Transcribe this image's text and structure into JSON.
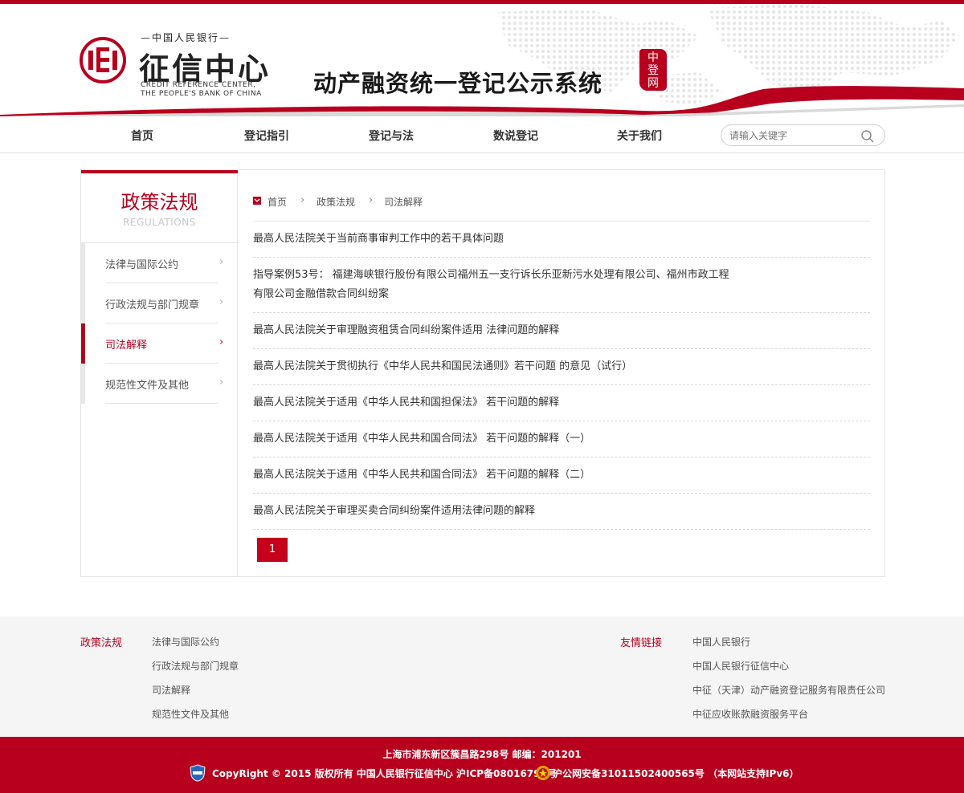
{
  "header": {
    "logo_top": "—中国人民银行—",
    "logo_main": "征信中心",
    "logo_en_line1": "CREDIT REFERENCE CENTER,",
    "logo_en_line2": "THE PEOPLE'S BANK OF CHINA",
    "system_title": "动产融资统一登记公示系统",
    "stamp_text": "中登网"
  },
  "nav": {
    "items": [
      "首页",
      "登记指引",
      "登记与法",
      "数说登记",
      "关于我们"
    ],
    "search_placeholder": "请输入关键字"
  },
  "sidebar": {
    "title": "政策法规",
    "subtitle": "REGULATIONS",
    "items": [
      {
        "label": "法律与国际公约",
        "active": false
      },
      {
        "label": "行政法规与部门规章",
        "active": false
      },
      {
        "label": "司法解释",
        "active": true
      },
      {
        "label": "规范性文件及其他",
        "active": false
      }
    ]
  },
  "breadcrumb": [
    "首页",
    "政策法规",
    "司法解释"
  ],
  "articles": [
    {
      "lines": [
        "最高人民法院关于当前商事审判工作中的若干具体问题"
      ]
    },
    {
      "lines": [
        "指导案例53号： 福建海峡银行股份有限公司福州五一支行诉长乐亚新污水处理有限公司、福州市政工程",
        "有限公司金融借款合同纠纷案"
      ]
    },
    {
      "lines": [
        "最高人民法院关于审理融资租赁合同纠纷案件适用 法律问题的解释"
      ]
    },
    {
      "lines": [
        "最高人民法院关于贯彻执行《中华人民共和国民法通则》若干问题 的意见（试行）"
      ]
    },
    {
      "lines": [
        "最高人民法院关于适用《中华人民共和国担保法》 若干问题的解释"
      ]
    },
    {
      "lines": [
        "最高人民法院关于适用《中华人民共和国合同法》 若干问题的解释（一）"
      ]
    },
    {
      "lines": [
        "最高人民法院关于适用《中华人民共和国合同法》 若干问题的解释（二）"
      ]
    },
    {
      "lines": [
        "最高人民法院关于审理买卖合同纠纷案件适用法律问题的解释"
      ]
    }
  ],
  "pagination": {
    "current": "1"
  },
  "footer": {
    "policy_heading": "政策法规",
    "policy_links": [
      "法律与国际公约",
      "行政法规与部门规章",
      "司法解释",
      "规范性文件及其他"
    ],
    "friend_heading": "友情链接",
    "friend_links": [
      "中国人民银行",
      "中国人民银行征信中心",
      "中征（天津）动产融资登记服务有限责任公司",
      "中征应收账款融资服务平台"
    ],
    "address": "上海市浦东新区簇昌路298号 邮编：201201",
    "copyright": "CopyRight © 2015 版权所有 中国人民银行征信中心 沪ICP备08016794号",
    "security": "沪公网安备31011502400565号 （本网站支持IPv6）"
  },
  "colors": {
    "brand_red": "#b8001e",
    "footer_gray": "#f5f5f5"
  }
}
